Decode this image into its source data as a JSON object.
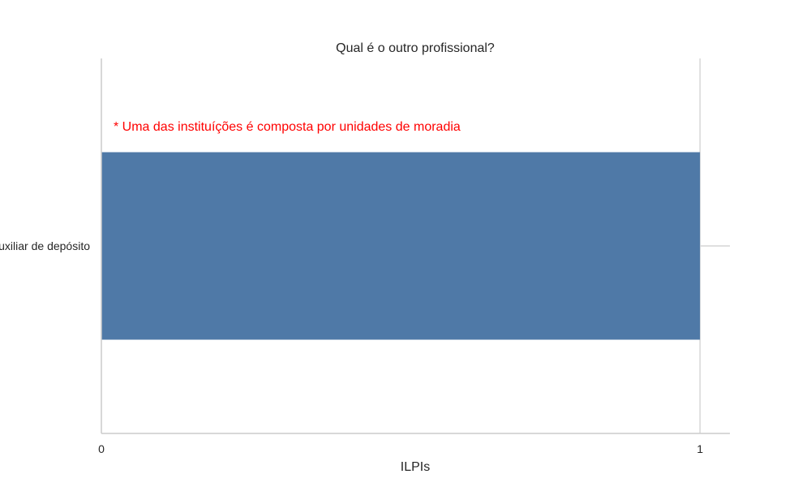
{
  "chart_data": {
    "type": "bar",
    "orientation": "horizontal",
    "title": "Qual é o outro profissional?",
    "xlabel": "ILPIs",
    "ylabel": "",
    "categories": [
      "Auxiliar de depósito"
    ],
    "values": [
      1
    ],
    "xlim": [
      0,
      1.05
    ],
    "xticks": [
      0,
      1
    ],
    "grid": "vertical",
    "bar_color": "#4f79a7",
    "annotation": {
      "text": "* Uma das instituíções é composta por unidades de moradia",
      "color": "#ff0000"
    }
  }
}
